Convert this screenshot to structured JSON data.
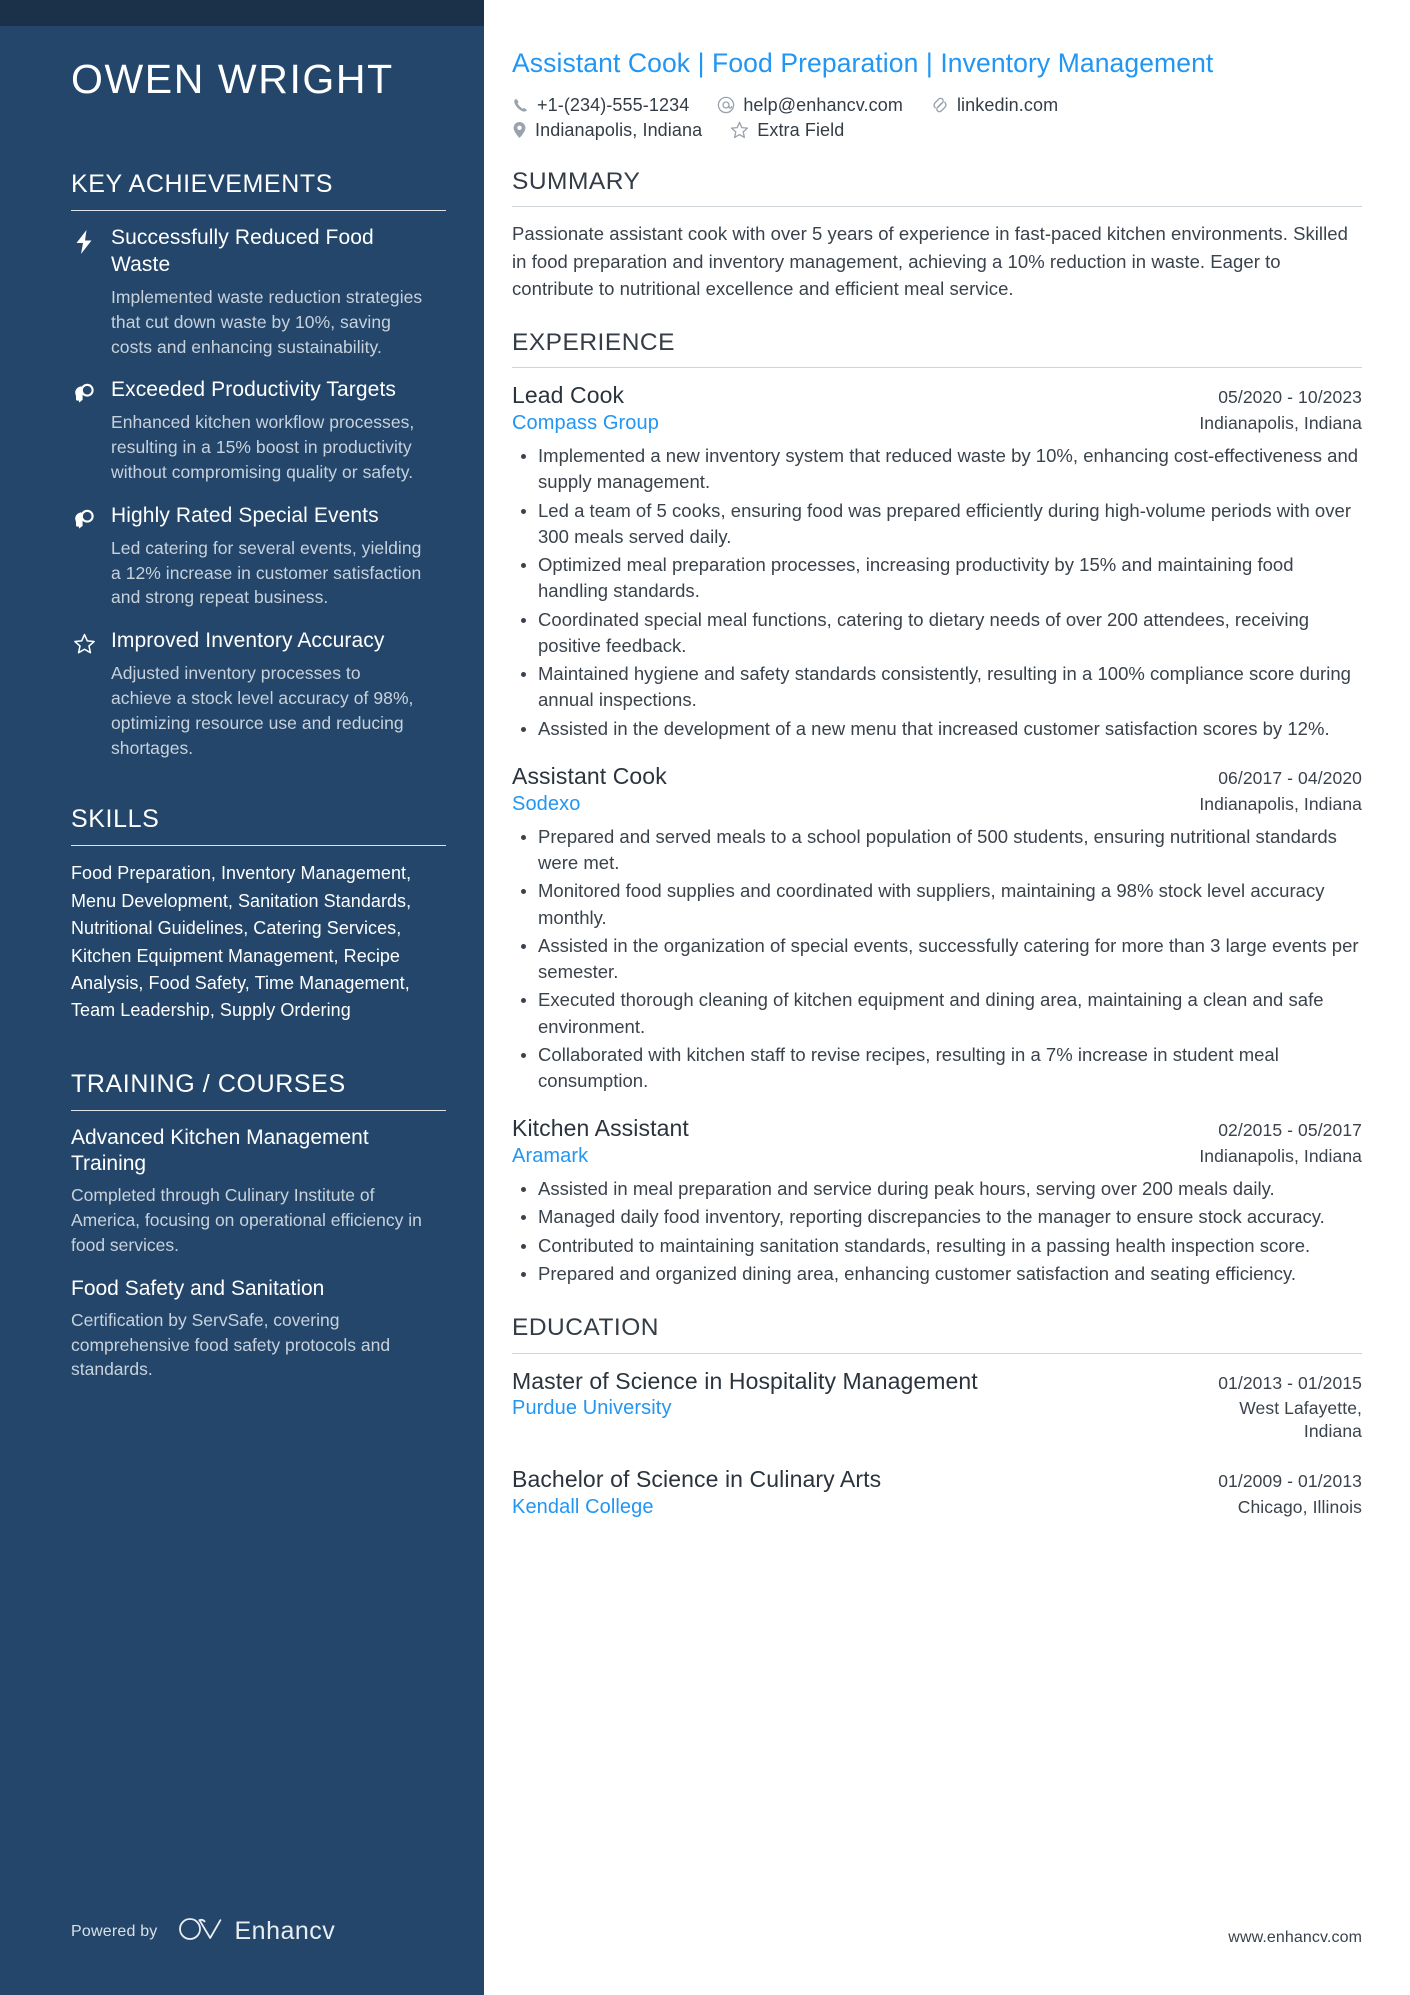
{
  "colors": {
    "sidebar_bg": "#23466a",
    "sidebar_top_strip": "#1a3149",
    "accent_blue": "#2196f3",
    "body_text": "#3a424c"
  },
  "sidebar": {
    "name": "OWEN WRIGHT",
    "sections": {
      "key_achievements": {
        "heading": "KEY ACHIEVEMENTS",
        "items": [
          {
            "icon": "lightning-bolt-icon",
            "title": "Successfully Reduced Food Waste",
            "description": "Implemented waste reduction strategies that cut down waste by 10%, saving costs and enhancing sustainability."
          },
          {
            "icon": "head-idea-icon",
            "title": "Exceeded Productivity Targets",
            "description": "Enhanced kitchen workflow processes, resulting in a 15% boost in productivity without compromising quality or safety."
          },
          {
            "icon": "head-idea-icon",
            "title": "Highly Rated Special Events",
            "description": "Led catering for several events, yielding a 12% increase in customer satisfaction and strong repeat business."
          },
          {
            "icon": "star-outline-icon",
            "title": "Improved Inventory Accuracy",
            "description": "Adjusted inventory processes to achieve a stock level accuracy of 98%, optimizing resource use and reducing shortages."
          }
        ]
      },
      "skills": {
        "heading": "SKILLS",
        "text": "Food Preparation, Inventory Management, Menu Development, Sanitation Standards, Nutritional Guidelines, Catering Services, Kitchen Equipment Management, Recipe Analysis, Food Safety, Time Management, Team Leadership, Supply Ordering"
      },
      "training": {
        "heading": "TRAINING / COURSES",
        "items": [
          {
            "title": "Advanced Kitchen Management Training",
            "description": "Completed through Culinary Institute of America, focusing on operational efficiency in food services."
          },
          {
            "title": "Food Safety and Sanitation",
            "description": "Certification by ServSafe, covering comprehensive food safety protocols and standards."
          }
        ]
      }
    },
    "footer": {
      "powered_by": "Powered by",
      "brand": "Enhancv",
      "logo_icon": "enhancv-logo-icon"
    }
  },
  "main": {
    "headline": "Assistant Cook | Food Preparation | Inventory Management",
    "contact": {
      "row1": [
        {
          "icon": "phone-icon",
          "value": "+1-(234)-555-1234"
        },
        {
          "icon": "email-at-icon",
          "value": "help@enhancv.com"
        },
        {
          "icon": "link-icon",
          "value": "linkedin.com"
        }
      ],
      "row2": [
        {
          "icon": "location-pin-icon",
          "value": "Indianapolis, Indiana"
        },
        {
          "icon": "star-outline-icon",
          "value": "Extra Field"
        }
      ]
    },
    "summary": {
      "heading": "SUMMARY",
      "text": "Passionate assistant cook with over 5 years of experience in fast-paced kitchen environments. Skilled in food preparation and inventory management, achieving a 10% reduction in waste. Eager to contribute to nutritional excellence and efficient meal service."
    },
    "experience": {
      "heading": "EXPERIENCE",
      "entries": [
        {
          "title": "Lead Cook",
          "date": "05/2020 - 10/2023",
          "organization": "Compass Group",
          "location": "Indianapolis, Indiana",
          "bullets": [
            "Implemented a new inventory system that reduced waste by 10%, enhancing cost-effectiveness and supply management.",
            "Led a team of 5 cooks, ensuring food was prepared efficiently during high-volume periods with over 300 meals served daily.",
            "Optimized meal preparation processes, increasing productivity by 15% and maintaining food handling standards.",
            "Coordinated special meal functions, catering to dietary needs of over 200 attendees, receiving positive feedback.",
            "Maintained hygiene and safety standards consistently, resulting in a 100% compliance score during annual inspections.",
            "Assisted in the development of a new menu that increased customer satisfaction scores by 12%."
          ]
        },
        {
          "title": "Assistant Cook",
          "date": "06/2017 - 04/2020",
          "organization": "Sodexo",
          "location": "Indianapolis, Indiana",
          "bullets": [
            "Prepared and served meals to a school population of 500 students, ensuring nutritional standards were met.",
            "Monitored food supplies and coordinated with suppliers, maintaining a 98% stock level accuracy monthly.",
            "Assisted in the organization of special events, successfully catering for more than 3 large events per semester.",
            "Executed thorough cleaning of kitchen equipment and dining area, maintaining a clean and safe environment.",
            "Collaborated with kitchen staff to revise recipes, resulting in a 7% increase in student meal consumption."
          ]
        },
        {
          "title": "Kitchen Assistant",
          "date": "02/2015 - 05/2017",
          "organization": "Aramark",
          "location": "Indianapolis, Indiana",
          "bullets": [
            "Assisted in meal preparation and service during peak hours, serving over 200 meals daily.",
            "Managed daily food inventory, reporting discrepancies to the manager to ensure stock accuracy.",
            "Contributed to maintaining sanitation standards, resulting in a passing health inspection score.",
            "Prepared and organized dining area, enhancing customer satisfaction and seating efficiency."
          ]
        }
      ]
    },
    "education": {
      "heading": "EDUCATION",
      "entries": [
        {
          "title": "Master of Science in Hospitality Management",
          "date": "01/2013 - 01/2015",
          "organization": "Purdue University",
          "location": "West Lafayette, Indiana"
        },
        {
          "title": "Bachelor of Science in Culinary Arts",
          "date": "01/2009 - 01/2013",
          "organization": "Kendall College",
          "location": "Chicago, Illinois"
        }
      ]
    },
    "footer_url": "www.enhancv.com"
  }
}
